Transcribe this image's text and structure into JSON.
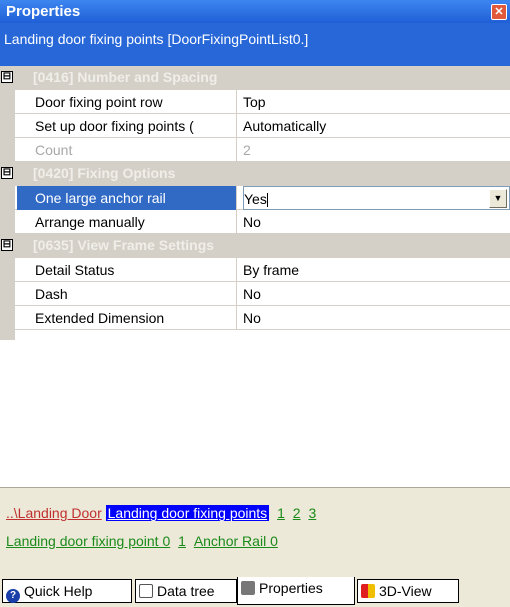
{
  "window": {
    "title": "Properties"
  },
  "subtitle": "Landing door fixing points [DoorFixingPointList0.]",
  "categories": {
    "c0": {
      "label": "[0416] Number and Spacing",
      "toggle": "⊟"
    },
    "c1": {
      "label": "[0420] Fixing Options",
      "toggle": "⊟"
    },
    "c2": {
      "label": "[0635] View Frame Settings",
      "toggle": "⊟"
    }
  },
  "props": {
    "r0": {
      "name": "Door fixing point row",
      "value": "Top"
    },
    "r1": {
      "name": "Set up door fixing points (",
      "value": "Automatically"
    },
    "r2": {
      "name": "Count",
      "value": "2"
    },
    "r3": {
      "name": "One large anchor rail",
      "value": "Yes"
    },
    "r4": {
      "name": "Arrange manually",
      "value": "No"
    },
    "r5": {
      "name": "Detail Status",
      "value": "By frame"
    },
    "r6": {
      "name": "Dash",
      "value": "No"
    },
    "r7": {
      "name": "Extended Dimension",
      "value": "No"
    }
  },
  "nav": {
    "back": "..\\Landing Door",
    "current": "Landing door fixing points",
    "p1": "1",
    "p2": "2",
    "p3": "3",
    "child": "Landing door fixing point 0",
    "c1": "1",
    "rail": "Anchor Rail 0"
  },
  "tabs": {
    "help": "Quick Help",
    "tree": "Data tree",
    "props": "Properties",
    "view3d": "3D-View"
  },
  "icons": {
    "close": "close-icon",
    "dropdown": "chevron-down-icon"
  },
  "colors": {
    "title_bar": "#2767d8",
    "selection": "#316ac5",
    "current_link": "#0000ff",
    "link_green": "#1a8a1a",
    "link_back": "#c03030"
  }
}
